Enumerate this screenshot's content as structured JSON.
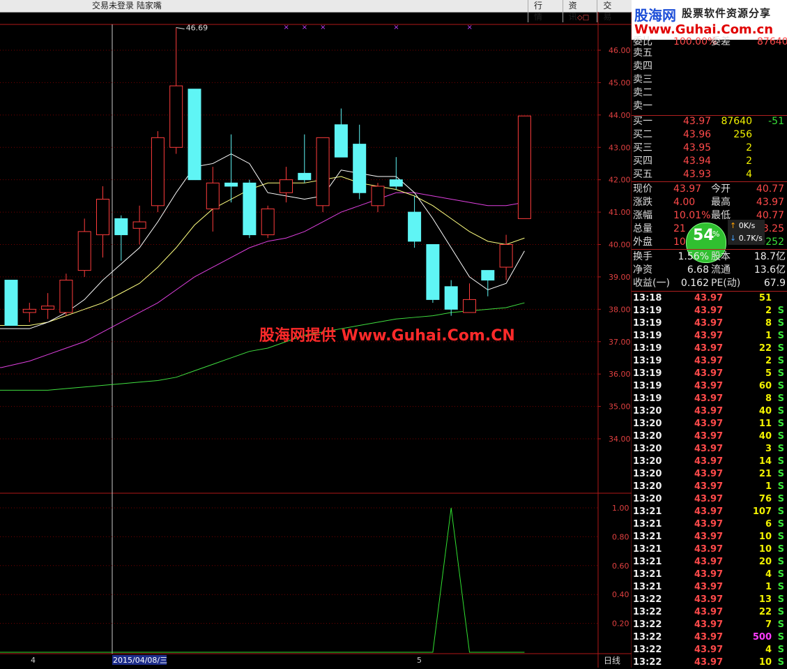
{
  "topbar": {
    "status": "交易未登录   陆家嘴",
    "tabs": [
      "行 情",
      "资 讯",
      "交 易"
    ]
  },
  "chart": {
    "high_marker": "46.69",
    "y_axis_main": [
      "46.00",
      "45.00",
      "44.00",
      "43.00",
      "42.00",
      "41.00",
      "40.00",
      "39.00",
      "38.00",
      "37.00",
      "36.00",
      "35.00",
      "34.00"
    ],
    "y_axis_sub": [
      "1.00",
      "0.80",
      "0.60",
      "0.40",
      "0.20"
    ],
    "x_labels": [
      "4",
      "2015/04/08/三",
      "5"
    ],
    "period_label": "日线",
    "watermark": "股海网提供 Www.Guhai.Com.CN",
    "colors": {
      "up": "#ff3c3c",
      "down": "#5ff5f5",
      "grid": "#7a0000",
      "ma5": "#ffffff",
      "ma10": "#ffff80",
      "ma20": "#e040e0",
      "ma60": "#40e040"
    }
  },
  "chart_data": {
    "type": "candlestick",
    "ylim": [
      33.5,
      47.0
    ],
    "candles": [
      {
        "o": 37.5,
        "h": 38.9,
        "l": 37.5,
        "c": 38.9,
        "dir": "down"
      },
      {
        "o": 37.9,
        "h": 38.2,
        "l": 37.6,
        "c": 38.0,
        "dir": "up"
      },
      {
        "o": 38.0,
        "h": 38.5,
        "l": 37.7,
        "c": 38.1,
        "dir": "up"
      },
      {
        "o": 37.9,
        "h": 39.1,
        "l": 37.8,
        "c": 38.9,
        "dir": "up"
      },
      {
        "o": 39.2,
        "h": 40.8,
        "l": 39.0,
        "c": 40.4,
        "dir": "up"
      },
      {
        "o": 40.3,
        "h": 41.8,
        "l": 39.6,
        "c": 41.4,
        "dir": "up"
      },
      {
        "o": 40.3,
        "h": 40.9,
        "l": 39.5,
        "c": 40.8,
        "dir": "down"
      },
      {
        "o": 40.5,
        "h": 41.2,
        "l": 40.0,
        "c": 40.7,
        "dir": "up"
      },
      {
        "o": 41.2,
        "h": 43.5,
        "l": 41.0,
        "c": 43.3,
        "dir": "up"
      },
      {
        "o": 43.0,
        "h": 46.7,
        "l": 42.8,
        "c": 44.9,
        "dir": "up"
      },
      {
        "o": 44.8,
        "h": 44.8,
        "l": 42.0,
        "c": 42.0,
        "dir": "down"
      },
      {
        "o": 41.1,
        "h": 42.4,
        "l": 40.4,
        "c": 41.9,
        "dir": "up"
      },
      {
        "o": 41.9,
        "h": 43.4,
        "l": 41.3,
        "c": 41.8,
        "dir": "down"
      },
      {
        "o": 41.9,
        "h": 42.0,
        "l": 40.2,
        "c": 40.3,
        "dir": "down"
      },
      {
        "o": 40.3,
        "h": 41.2,
        "l": 40.2,
        "c": 41.1,
        "dir": "up"
      },
      {
        "o": 41.6,
        "h": 42.4,
        "l": 41.3,
        "c": 42.0,
        "dir": "up"
      },
      {
        "o": 42.2,
        "h": 43.4,
        "l": 41.9,
        "c": 42.0,
        "dir": "down"
      },
      {
        "o": 41.2,
        "h": 43.3,
        "l": 41.0,
        "c": 43.3,
        "dir": "up"
      },
      {
        "o": 43.7,
        "h": 44.2,
        "l": 42.7,
        "c": 42.7,
        "dir": "down"
      },
      {
        "o": 43.1,
        "h": 43.7,
        "l": 41.4,
        "c": 41.6,
        "dir": "down"
      },
      {
        "o": 41.2,
        "h": 41.9,
        "l": 41.0,
        "c": 41.8,
        "dir": "up"
      },
      {
        "o": 42.0,
        "h": 42.7,
        "l": 41.7,
        "c": 41.8,
        "dir": "down"
      },
      {
        "o": 41.0,
        "h": 41.5,
        "l": 39.9,
        "c": 40.1,
        "dir": "down"
      },
      {
        "o": 40.0,
        "h": 40.0,
        "l": 38.2,
        "c": 38.3,
        "dir": "down"
      },
      {
        "o": 38.7,
        "h": 38.9,
        "l": 37.8,
        "c": 38.0,
        "dir": "down"
      },
      {
        "o": 37.9,
        "h": 38.8,
        "l": 37.9,
        "c": 38.3,
        "dir": "up"
      },
      {
        "o": 39.2,
        "h": 39.2,
        "l": 38.4,
        "c": 38.9,
        "dir": "down"
      },
      {
        "o": 39.3,
        "h": 40.3,
        "l": 38.9,
        "c": 40.0,
        "dir": "up"
      },
      {
        "o": 40.8,
        "h": 43.97,
        "l": 40.8,
        "c": 43.97,
        "dir": "up"
      }
    ],
    "ma5": [
      37.4,
      37.4,
      37.6,
      37.9,
      38.3,
      38.9,
      39.4,
      39.9,
      40.7,
      41.6,
      42.4,
      42.5,
      42.8,
      42.5,
      41.6,
      41.5,
      41.4,
      41.5,
      42.3,
      42.2,
      42.1,
      42.1,
      41.6,
      40.8,
      39.9,
      39.0,
      38.6,
      38.8,
      39.8
    ],
    "ma10": [
      37.5,
      37.5,
      37.6,
      37.8,
      38.0,
      38.2,
      38.5,
      38.8,
      39.3,
      39.9,
      40.6,
      41.1,
      41.4,
      41.7,
      41.9,
      41.9,
      41.9,
      42.0,
      42.1,
      41.9,
      41.8,
      41.7,
      41.5,
      41.2,
      40.8,
      40.4,
      40.1,
      40.0,
      40.2
    ],
    "ma20": [
      36.2,
      36.4,
      36.6,
      36.8,
      37.0,
      37.3,
      37.6,
      37.9,
      38.2,
      38.6,
      39.0,
      39.3,
      39.6,
      39.9,
      40.1,
      40.2,
      40.4,
      40.7,
      41.0,
      41.2,
      41.4,
      41.6,
      41.6,
      41.5,
      41.4,
      41.3,
      41.2,
      41.2,
      41.3
    ],
    "ma60": [
      35.5,
      35.5,
      35.5,
      35.55,
      35.6,
      35.65,
      35.7,
      35.75,
      35.8,
      35.9,
      36.1,
      36.3,
      36.5,
      36.7,
      36.8,
      37.0,
      37.2,
      37.3,
      37.4,
      37.5,
      37.6,
      37.7,
      37.75,
      37.8,
      37.9,
      37.95,
      38.0,
      38.05,
      38.2
    ],
    "marks_x": [
      15,
      16,
      17,
      21,
      25
    ],
    "indicator": [
      0,
      0,
      0,
      0,
      0,
      0,
      0,
      0,
      0,
      0,
      0,
      0,
      0,
      0,
      0,
      0,
      0,
      0,
      0,
      0,
      0,
      0,
      0,
      0,
      1,
      0,
      0,
      0,
      0
    ],
    "indicator_ylim": [
      0,
      1.05
    ]
  },
  "banner": {
    "logo": "股海网",
    "tagline": "股票软件资源分享",
    "url": "Www.Guhai.Com.cn"
  },
  "quote": {
    "weibi_label": "委比",
    "weibi_value": "100.00%",
    "weicha_label": "委差",
    "weicha_value": "87640",
    "sell": [
      {
        "label": "卖五"
      },
      {
        "label": "卖四"
      },
      {
        "label": "卖三"
      },
      {
        "label": "卖二"
      },
      {
        "label": "卖一"
      }
    ],
    "buy": [
      {
        "label": "买一",
        "price": "43.97",
        "vol": "87640",
        "chg": "-51"
      },
      {
        "label": "买二",
        "price": "43.96",
        "vol": "256",
        "chg": ""
      },
      {
        "label": "买三",
        "price": "43.95",
        "vol": "2",
        "chg": ""
      },
      {
        "label": "买四",
        "price": "43.94",
        "vol": "2",
        "chg": ""
      },
      {
        "label": "买五",
        "price": "43.93",
        "vol": "4",
        "chg": ""
      }
    ],
    "stats": [
      {
        "l1": "现价",
        "v1": "43.97",
        "l2": "今开",
        "v2": "40.77"
      },
      {
        "l1": "涨跌",
        "v1": "4.00",
        "l2": "最高",
        "v2": "43.97"
      },
      {
        "l1": "涨幅",
        "v1": "10.01%",
        "l2": "最低",
        "v2": "40.77"
      },
      {
        "l1": "总量",
        "v1": "21",
        "l2": "",
        "v2": "3.25"
      },
      {
        "l1": "外盘",
        "v1": "10",
        "l2": "盘",
        "v2": "110252"
      }
    ],
    "gauge": {
      "value": "54",
      "unit": "%"
    },
    "speed_up": "0K/s",
    "speed_down": "0.7K/s",
    "fin": [
      {
        "l1": "换手",
        "v1": "1.56%",
        "l2": "股本",
        "v2": "18.7亿"
      },
      {
        "l1": "净资",
        "v1": "6.68",
        "l2": "流通",
        "v2": "13.6亿"
      },
      {
        "l1": "收益(一)",
        "v1": "0.162",
        "l2": "PE(动)",
        "v2": "67.9"
      }
    ]
  },
  "ticks": [
    {
      "t": "13:18",
      "p": "43.97",
      "v": "51",
      "s": ""
    },
    {
      "t": "13:19",
      "p": "43.97",
      "v": "2",
      "s": "S"
    },
    {
      "t": "13:19",
      "p": "43.97",
      "v": "8",
      "s": "S"
    },
    {
      "t": "13:19",
      "p": "43.97",
      "v": "1",
      "s": "S"
    },
    {
      "t": "13:19",
      "p": "43.97",
      "v": "22",
      "s": "S"
    },
    {
      "t": "13:19",
      "p": "43.97",
      "v": "2",
      "s": "S"
    },
    {
      "t": "13:19",
      "p": "43.97",
      "v": "5",
      "s": "S"
    },
    {
      "t": "13:19",
      "p": "43.97",
      "v": "60",
      "s": "S"
    },
    {
      "t": "13:19",
      "p": "43.97",
      "v": "8",
      "s": "S"
    },
    {
      "t": "13:20",
      "p": "43.97",
      "v": "40",
      "s": "S"
    },
    {
      "t": "13:20",
      "p": "43.97",
      "v": "11",
      "s": "S"
    },
    {
      "t": "13:20",
      "p": "43.97",
      "v": "40",
      "s": "S"
    },
    {
      "t": "13:20",
      "p": "43.97",
      "v": "3",
      "s": "S"
    },
    {
      "t": "13:20",
      "p": "43.97",
      "v": "14",
      "s": "S"
    },
    {
      "t": "13:20",
      "p": "43.97",
      "v": "21",
      "s": "S"
    },
    {
      "t": "13:20",
      "p": "43.97",
      "v": "1",
      "s": "S"
    },
    {
      "t": "13:20",
      "p": "43.97",
      "v": "76",
      "s": "S"
    },
    {
      "t": "13:21",
      "p": "43.97",
      "v": "107",
      "s": "S"
    },
    {
      "t": "13:21",
      "p": "43.97",
      "v": "6",
      "s": "S"
    },
    {
      "t": "13:21",
      "p": "43.97",
      "v": "10",
      "s": "S"
    },
    {
      "t": "13:21",
      "p": "43.97",
      "v": "10",
      "s": "S"
    },
    {
      "t": "13:21",
      "p": "43.97",
      "v": "20",
      "s": "S"
    },
    {
      "t": "13:21",
      "p": "43.97",
      "v": "4",
      "s": "S"
    },
    {
      "t": "13:21",
      "p": "43.97",
      "v": "1",
      "s": "S"
    },
    {
      "t": "13:22",
      "p": "43.97",
      "v": "13",
      "s": "S"
    },
    {
      "t": "13:22",
      "p": "43.97",
      "v": "22",
      "s": "S"
    },
    {
      "t": "13:22",
      "p": "43.97",
      "v": "7",
      "s": "S"
    },
    {
      "t": "13:22",
      "p": "43.97",
      "v": "500",
      "s": "S"
    },
    {
      "t": "13:22",
      "p": "43.97",
      "v": "4",
      "s": "S"
    },
    {
      "t": "13:22",
      "p": "43.97",
      "v": "10",
      "s": "S"
    }
  ]
}
